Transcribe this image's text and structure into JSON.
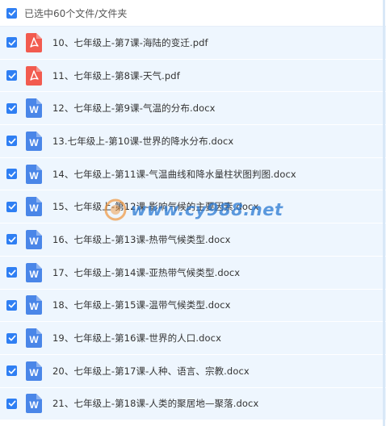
{
  "header": {
    "selection_text": "已选中60个文件/文件夹"
  },
  "files": [
    {
      "name": "10、七年级上-第7课-海陆的变迁.pdf",
      "type": "pdf"
    },
    {
      "name": "11、七年级上-第8课-天气.pdf",
      "type": "pdf"
    },
    {
      "name": "12、七年级上-第9课-气温的分布.docx",
      "type": "docx"
    },
    {
      "name": "13.七年级上-第10课-世界的降水分布.docx",
      "type": "docx"
    },
    {
      "name": "14、七年级上-第11课-气温曲线和降水量柱状图判图.docx",
      "type": "docx"
    },
    {
      "name": "15、七年级上-第12课-影响气候的主要因素.docx",
      "type": "docx"
    },
    {
      "name": "16、七年级上-第13课-热带气候类型.docx",
      "type": "docx"
    },
    {
      "name": "17、七年级上-第14课-亚热带气候类型.docx",
      "type": "docx"
    },
    {
      "name": "18、七年级上-第15课-温带气候类型.docx",
      "type": "docx"
    },
    {
      "name": "19、七年级上-第16课-世界的人口.docx",
      "type": "docx"
    },
    {
      "name": "20、七年级上-第17课-人种、语言、宗教.docx",
      "type": "docx"
    },
    {
      "name": "21、七年级上-第18课-人类的聚居地—聚落.docx",
      "type": "docx"
    }
  ],
  "watermark": {
    "text": "www.cy988.net"
  },
  "colors": {
    "checkbox": "#2f7ff3",
    "pdf_icon": "#f25b4f",
    "doc_icon": "#4a86e8",
    "row_bg": "#eef6fe"
  }
}
